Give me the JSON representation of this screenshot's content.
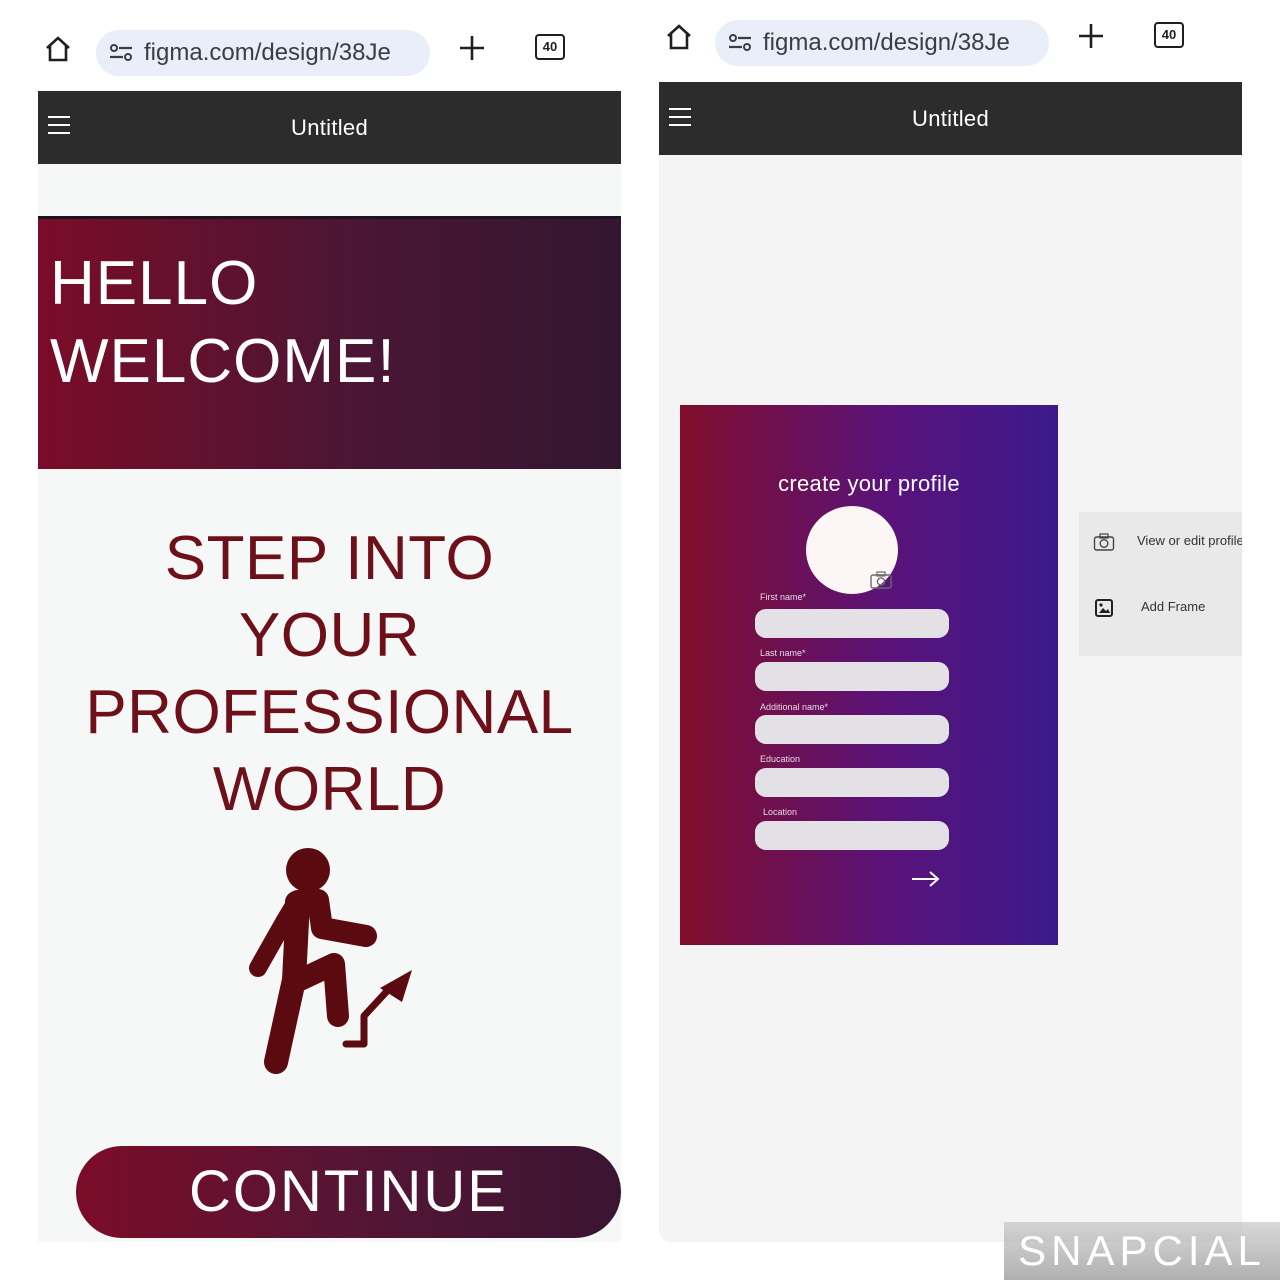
{
  "left_screen": {
    "browser": {
      "url": "figma.com/design/38Je",
      "tab_count": "40"
    },
    "app_title": "Untitled",
    "hero_lines": [
      "HELLO",
      "WELCOME!"
    ],
    "headline_lines": [
      "STEP INTO",
      "YOUR",
      "PROFESSIONAL",
      "WORLD"
    ],
    "continue_label": "CONTINUE",
    "colors": {
      "hero_start": "#7a0c28",
      "hero_end": "#331630",
      "headline": "#6e1019",
      "figure": "#5b0a10"
    }
  },
  "right_screen": {
    "browser": {
      "url": "figma.com/design/38Je",
      "tab_count": "40"
    },
    "app_title": "Untitled",
    "frame": {
      "title": "create your profile",
      "fields": [
        {
          "label": "First name*"
        },
        {
          "label": "Last name*"
        },
        {
          "label": "Additional name*"
        },
        {
          "label": "Education"
        },
        {
          "label": "Location"
        }
      ],
      "colors": {
        "start": "#800d2b",
        "end": "#3b1a8c"
      }
    },
    "context_menu": {
      "items": [
        {
          "label": "View or edit profile",
          "icon": "camera-icon"
        },
        {
          "label": "Add Frame",
          "icon": "image-icon"
        }
      ]
    }
  },
  "watermark": "SNAPCIAL"
}
